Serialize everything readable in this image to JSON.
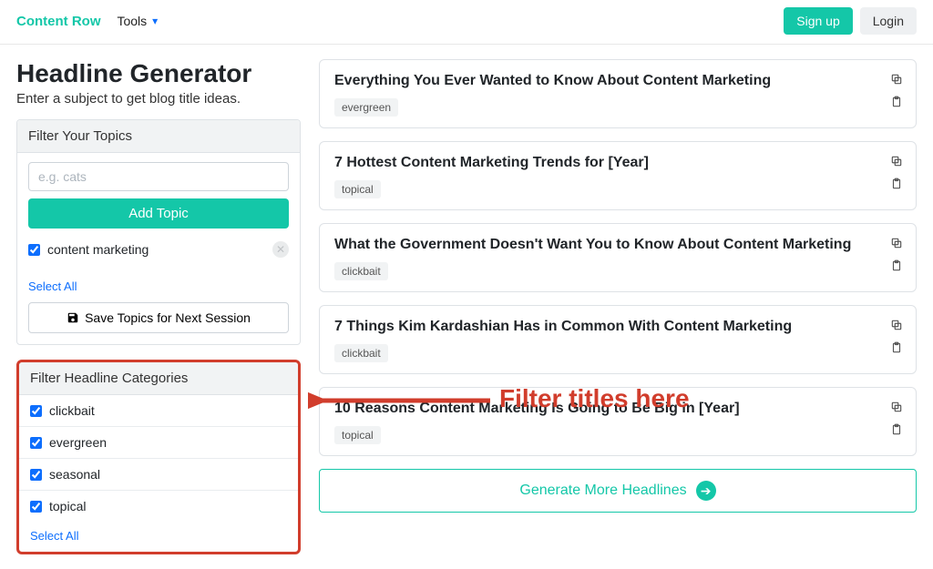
{
  "header": {
    "brand": "Content Row",
    "tools_label": "Tools",
    "signup_label": "Sign up",
    "login_label": "Login"
  },
  "page": {
    "title": "Headline Generator",
    "subtitle": "Enter a subject to get blog title ideas."
  },
  "topics_panel": {
    "header": "Filter Your Topics",
    "placeholder": "e.g. cats",
    "add_button": "Add Topic",
    "save_button": "Save Topics for Next Session",
    "select_all": "Select All",
    "topics": [
      {
        "label": "content marketing",
        "checked": true
      }
    ]
  },
  "categories_panel": {
    "header": "Filter Headline Categories",
    "select_all": "Select All",
    "items": [
      {
        "label": "clickbait",
        "checked": true
      },
      {
        "label": "evergreen",
        "checked": true
      },
      {
        "label": "seasonal",
        "checked": true
      },
      {
        "label": "topical",
        "checked": true
      }
    ]
  },
  "headlines": [
    {
      "title": "Everything You Ever Wanted to Know About Content Marketing",
      "tag": "evergreen"
    },
    {
      "title": "7 Hottest Content Marketing Trends for [Year]",
      "tag": "topical"
    },
    {
      "title": "What the Government Doesn't Want You to Know About Content Marketing",
      "tag": "clickbait"
    },
    {
      "title": "7 Things Kim Kardashian Has in Common With Content Marketing",
      "tag": "clickbait"
    },
    {
      "title": "10 Reasons Content Marketing Is Going to Be Big in [Year]",
      "tag": "topical"
    }
  ],
  "generate_more": "Generate More Headlines",
  "annotation_text": "Filter titles here"
}
